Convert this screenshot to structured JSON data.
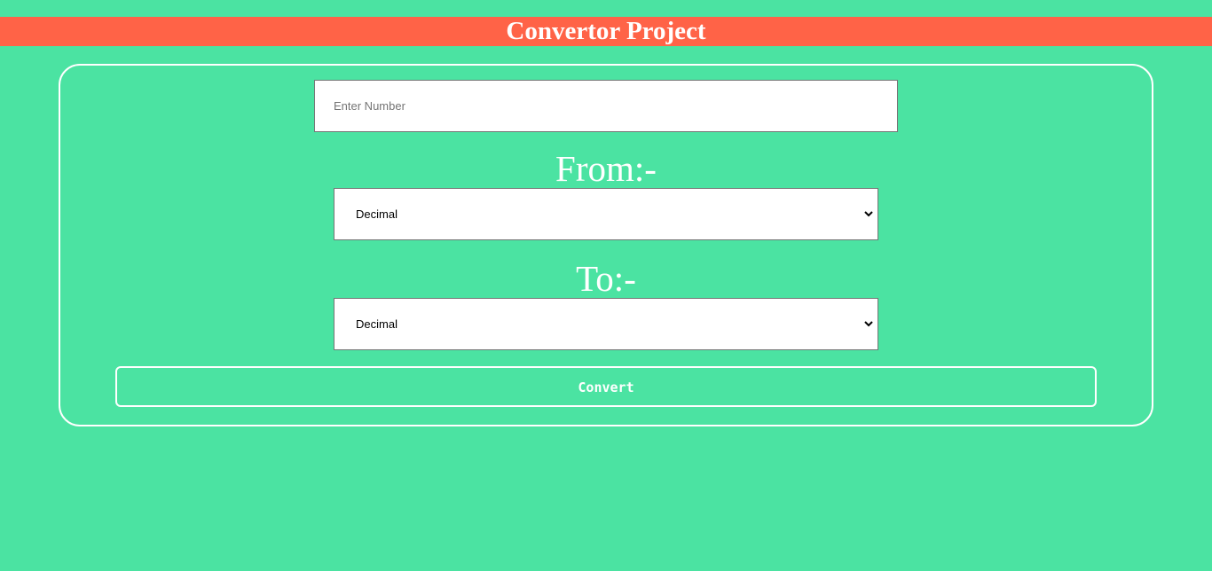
{
  "header": {
    "title": "Convertor Project"
  },
  "form": {
    "number_input": {
      "placeholder": "Enter Number",
      "value": ""
    },
    "from": {
      "label": "From:-",
      "selected": "Decimal"
    },
    "to": {
      "label": "To:-",
      "selected": "Decimal"
    },
    "convert_label": "Convert"
  },
  "icons": {
    "select_chevron": "chevron-down-icon"
  },
  "colors": {
    "background": "#4be3a2",
    "header_background": "#ff6347",
    "text": "#ffffff",
    "border": "#ffffff"
  }
}
